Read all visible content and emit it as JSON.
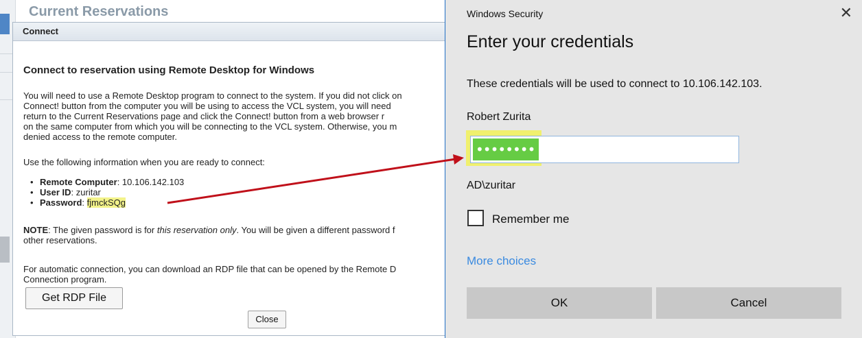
{
  "background_page": {
    "title": "Current Reservations"
  },
  "vcl_dialog": {
    "title": "Connect",
    "heading": "Connect to reservation using Remote Desktop for Windows",
    "paragraph_lines": [
      "You will need to use a Remote Desktop program to connect to the system. If you did not click on",
      "Connect! button from the computer you will be using to access the VCL system, you will need",
      "return to the Current Reservations page and click the Connect! button from a web browser r",
      "on the same computer from which you will be connecting to the VCL system. Otherwise, you m",
      "denied access to the remote computer."
    ],
    "use_info": "Use the following information when you are ready to connect:",
    "info": {
      "remote_computer_label": "Remote Computer",
      "remote_computer_value": ": 10.106.142.103",
      "user_id_label": "User ID",
      "user_id_value": ": zuritar",
      "password_label": "Password",
      "password_sep": ": ",
      "password_value": "fjmckSQg"
    },
    "note": {
      "label": "NOTE",
      "line1_a": ": The given password is for ",
      "line1_em": "this reservation only",
      "line1_b": ". You will be given a different password f",
      "line2": "other reservations."
    },
    "auto_lines": [
      "For automatic connection, you can download an RDP file that can be opened by the Remote D",
      "Connection program."
    ],
    "rdp_button": "Get RDP File",
    "close_button": "Close"
  },
  "windows_security": {
    "app_title": "Windows Security",
    "close_glyph": "✕",
    "heading": "Enter your credentials",
    "description": "These credentials will be used to connect to 10.106.142.103.",
    "username": "Robert Zurita",
    "password_mask": "••••••••",
    "domain_user": "AD\\zuritar",
    "remember_label": "Remember me",
    "more_choices": "More choices",
    "ok_label": "OK",
    "cancel_label": "Cancel"
  },
  "colors": {
    "highlight": "#f3f38a",
    "arrow": "#c0101a",
    "link": "#3a8ae0",
    "dialog_border": "#1f6fc5"
  }
}
